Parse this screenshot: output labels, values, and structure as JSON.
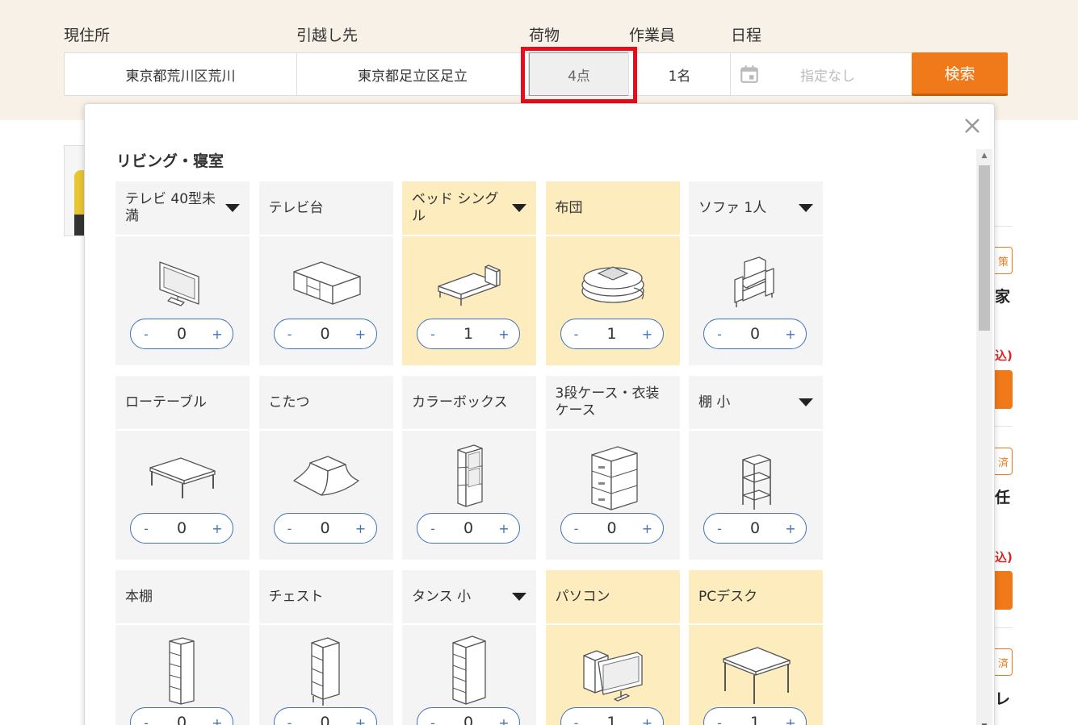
{
  "search": {
    "labels": {
      "from": "現住所",
      "to": "引越し先",
      "items": "荷物",
      "staff": "作業員",
      "date": "日程"
    },
    "from_value": "東京都荒川区荒川",
    "to_value": "東京都足立区足立",
    "items_value": "4点",
    "staff_value": "1名",
    "date_placeholder": "指定なし",
    "search_label": "検索"
  },
  "background": {
    "badges": [
      "策",
      "済",
      "済"
    ],
    "chars": [
      "家",
      "任",
      "レ"
    ],
    "red_marks": [
      "込)",
      "込)"
    ]
  },
  "modal": {
    "section_title": "リビング・寝室",
    "items": [
      {
        "name": "テレビ 40型未満",
        "count": "0",
        "dropdown": true,
        "selected": false,
        "icon": "tv-icon"
      },
      {
        "name": "テレビ台",
        "count": "0",
        "dropdown": false,
        "selected": false,
        "icon": "tv-stand-icon"
      },
      {
        "name": "ベッド シングル",
        "count": "1",
        "dropdown": true,
        "selected": true,
        "icon": "bed-icon"
      },
      {
        "name": "布団",
        "count": "1",
        "dropdown": false,
        "selected": true,
        "icon": "futon-icon"
      },
      {
        "name": "ソファ 1人",
        "count": "0",
        "dropdown": true,
        "selected": false,
        "icon": "sofa-icon"
      },
      {
        "name": "ローテーブル",
        "count": "0",
        "dropdown": false,
        "selected": false,
        "icon": "low-table-icon"
      },
      {
        "name": "こたつ",
        "count": "0",
        "dropdown": false,
        "selected": false,
        "icon": "kotatsu-icon"
      },
      {
        "name": "カラーボックス",
        "count": "0",
        "dropdown": false,
        "selected": false,
        "icon": "color-box-icon"
      },
      {
        "name": "3段ケース・衣装ケース",
        "count": "0",
        "dropdown": false,
        "selected": false,
        "icon": "storage-case-icon"
      },
      {
        "name": "棚 小",
        "count": "0",
        "dropdown": true,
        "selected": false,
        "icon": "small-shelf-icon"
      },
      {
        "name": "本棚",
        "count": "0",
        "dropdown": false,
        "selected": false,
        "icon": "bookshelf-icon"
      },
      {
        "name": "チェスト",
        "count": "0",
        "dropdown": false,
        "selected": false,
        "icon": "chest-icon"
      },
      {
        "name": "タンス 小",
        "count": "0",
        "dropdown": true,
        "selected": false,
        "icon": "dresser-icon"
      },
      {
        "name": "パソコン",
        "count": "1",
        "dropdown": false,
        "selected": true,
        "icon": "computer-icon"
      },
      {
        "name": "PCデスク",
        "count": "1",
        "dropdown": false,
        "selected": true,
        "icon": "pc-desk-icon"
      }
    ],
    "stepper_minus": "-",
    "stepper_plus": "+"
  }
}
